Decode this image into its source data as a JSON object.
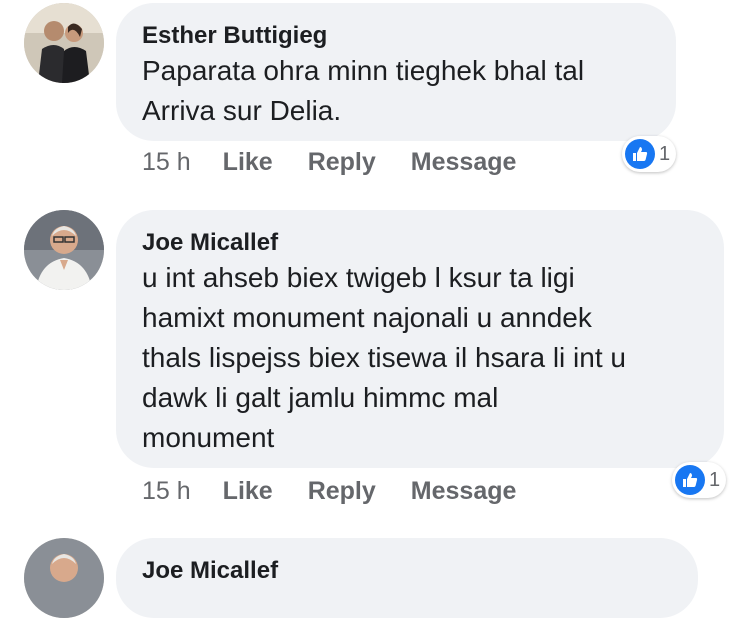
{
  "comments": [
    {
      "author": "Esther Buttigieg",
      "text_lines": [
        "Paparata ohra minn tieghek bhal tal",
        "Arriva sur Delia."
      ],
      "time": "15 h",
      "like_label": "Like",
      "reply_label": "Reply",
      "message_label": "Message",
      "reaction_count": "1"
    },
    {
      "author": "Joe Micallef",
      "text_lines": [
        "u int ahseb biex twigeb l ksur ta ligi",
        "hamixt monument najonali u anndek",
        "thals lispejss biex tisewa il hsara li int u",
        "dawk li galt jamlu himmc mal",
        "monument"
      ],
      "time": "15 h",
      "like_label": "Like",
      "reply_label": "Reply",
      "message_label": "Message",
      "reaction_count": "1"
    },
    {
      "author": "Joe Micallef"
    }
  ],
  "colors": {
    "bubble": "#f0f2f5",
    "like_blue": "#1877f2",
    "meta_gray": "#65676b"
  },
  "icons": {
    "reaction": "thumbs-up-icon"
  }
}
